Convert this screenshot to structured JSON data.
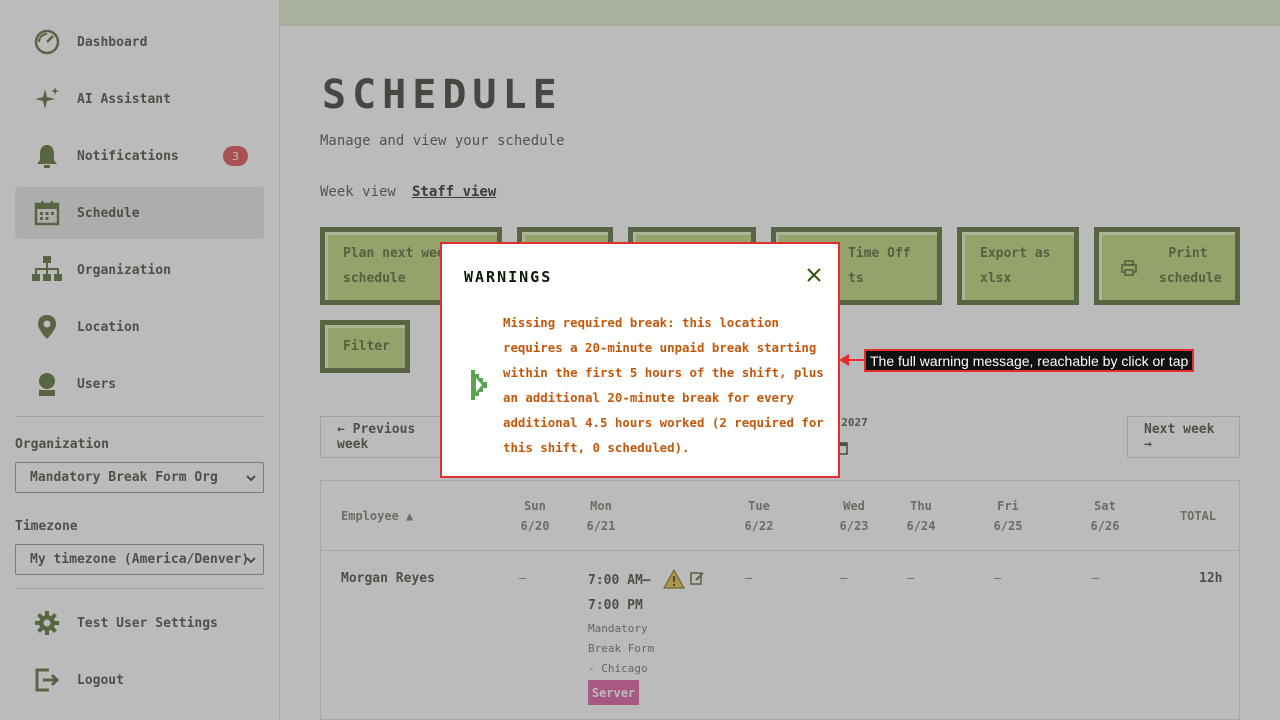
{
  "sidebar": {
    "items": [
      {
        "label": "Dashboard",
        "icon": "dashboard-gauge-icon"
      },
      {
        "label": "AI Assistant",
        "icon": "sparkle-icon"
      },
      {
        "label": "Notifications",
        "icon": "bell-icon",
        "badge": "3"
      },
      {
        "label": "Schedule",
        "icon": "calendar-icon",
        "active": true
      },
      {
        "label": "Organization",
        "icon": "org-chart-icon"
      },
      {
        "label": "Location",
        "icon": "map-pin-icon"
      },
      {
        "label": "Users",
        "icon": "user-icon"
      }
    ],
    "organization_label": "Organization",
    "organization_value": "Mandatory Break Form Org",
    "timezone_label": "Timezone",
    "timezone_value": "My timezone (America/Denver)",
    "settings_label": "Test User Settings",
    "logout_label": "Logout"
  },
  "page": {
    "title": "SCHEDULE",
    "subtitle": "Manage and view your schedule",
    "tabs": [
      "Week view",
      "Staff view"
    ],
    "active_tab": "Staff view"
  },
  "actions": {
    "plan_line1": "Plan next week",
    "plan_line2": "schedule",
    "time_off_line1": "Time Off",
    "time_off_line2": "ts",
    "export_line1": "Export as",
    "export_line2": "xlsx",
    "print_line1": "Print",
    "print_line2": "schedule",
    "filter": "Filter"
  },
  "week_nav": {
    "previous": "← Previous week",
    "next": "Next week →",
    "range_fragment": ", 2027"
  },
  "table": {
    "employee_header": "Employee ▲",
    "days": [
      {
        "name": "Sun",
        "date": "6/20"
      },
      {
        "name": "Mon",
        "date": "6/21"
      },
      {
        "name": "Tue",
        "date": "6/22"
      },
      {
        "name": "Wed",
        "date": "6/23"
      },
      {
        "name": "Thu",
        "date": "6/24"
      },
      {
        "name": "Fri",
        "date": "6/25"
      },
      {
        "name": "Sat",
        "date": "6/26"
      }
    ],
    "total_header": "TOTAL",
    "rows": [
      {
        "employee": "Morgan Reyes",
        "empty_cell": "–",
        "shift_start": "7:00 AM–",
        "shift_end": "7:00 PM",
        "location_lines": [
          "Mandatory",
          "Break Form",
          "- Chicago"
        ],
        "role": "Server",
        "total": "12h"
      }
    ]
  },
  "modal": {
    "title": "WARNINGS",
    "message": "Missing required break: this location requires a 20-minute unpaid break starting within the first 5 hours of the shift, plus an additional 20-minute break for every additional 4.5 hours worked (2 required for this shift, 0 scheduled)."
  },
  "callout": {
    "text": "The full warning message, reachable by click or tap"
  },
  "colors": {
    "primary_dark": "#36520f",
    "button_fill": "#b1cf60",
    "warning_text": "#c2580c",
    "badge": "#d62d2d",
    "role_tag": "#d63b8c",
    "modal_border": "#e52d2d"
  }
}
